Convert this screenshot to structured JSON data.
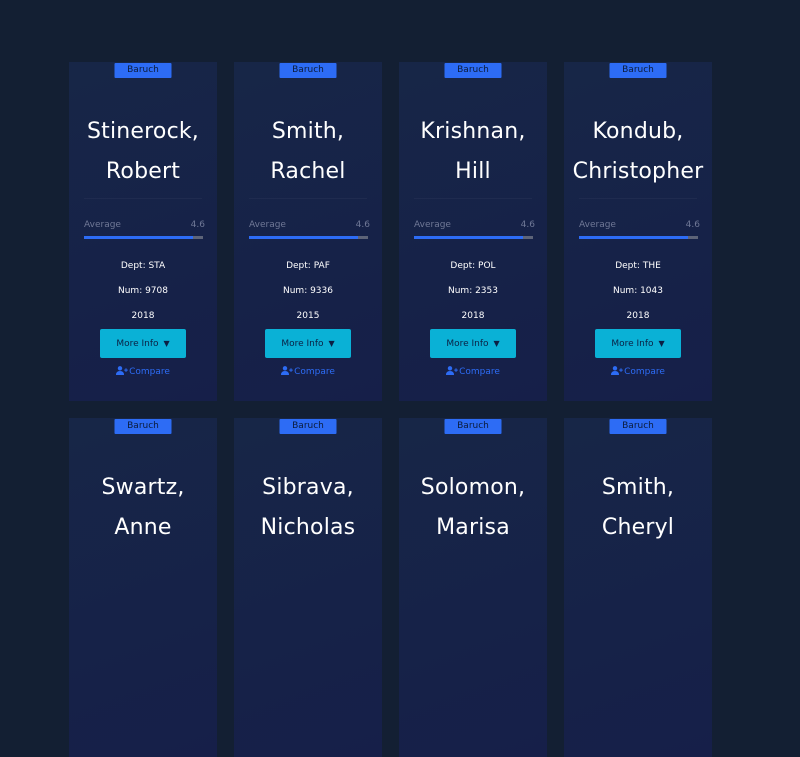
{
  "colors": {
    "background": "#131f33",
    "card": "#172647",
    "accent": "#2d6cf5",
    "button": "#0ab1d6"
  },
  "professors": [
    {
      "school": "Baruch",
      "name_line1": "Stinerock,",
      "name_line2": "Robert",
      "avg_label": "Average",
      "avg_value": "4.6",
      "avg_fraction": 0.92,
      "dept": "Dept: STA",
      "num": "Num: 9708",
      "year": "2018",
      "more_label": "More Info",
      "compare_label": "Compare"
    },
    {
      "school": "Baruch",
      "name_line1": "Smith,",
      "name_line2": "Rachel",
      "avg_label": "Average",
      "avg_value": "4.6",
      "avg_fraction": 0.92,
      "dept": "Dept: PAF",
      "num": "Num: 9336",
      "year": "2015",
      "more_label": "More Info",
      "compare_label": "Compare"
    },
    {
      "school": "Baruch",
      "name_line1": "Krishnan,",
      "name_line2": "Hill",
      "avg_label": "Average",
      "avg_value": "4.6",
      "avg_fraction": 0.92,
      "dept": "Dept: POL",
      "num": "Num: 2353",
      "year": "2018",
      "more_label": "More Info",
      "compare_label": "Compare"
    },
    {
      "school": "Baruch",
      "name_line1": "Kondub,",
      "name_line2": "Christopher",
      "avg_label": "Average",
      "avg_value": "4.6",
      "avg_fraction": 0.92,
      "dept": "Dept: THE",
      "num": "Num: 1043",
      "year": "2018",
      "more_label": "More Info",
      "compare_label": "Compare"
    },
    {
      "school": "Baruch",
      "name_line1": "Swartz,",
      "name_line2": "Anne"
    },
    {
      "school": "Baruch",
      "name_line1": "Sibrava,",
      "name_line2": "Nicholas"
    },
    {
      "school": "Baruch",
      "name_line1": "Solomon,",
      "name_line2": "Marisa"
    },
    {
      "school": "Baruch",
      "name_line1": "Smith,",
      "name_line2": "Cheryl"
    }
  ]
}
